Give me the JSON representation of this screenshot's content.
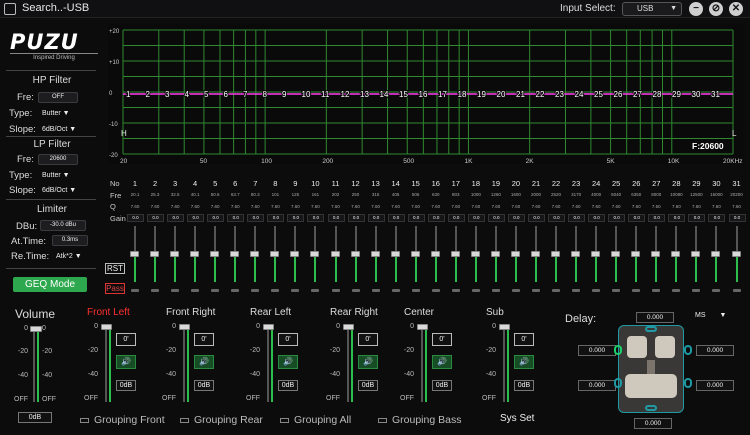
{
  "window": {
    "title": "Search..-USB",
    "input_select_label": "Input Select:",
    "input_select_value": "USB",
    "minimize_icon": "minus-icon",
    "restore_icon": "restore-icon",
    "close_icon": "close-icon"
  },
  "brand": {
    "logo": "PUZU",
    "tagline": "Inspired Driving"
  },
  "hp_filter": {
    "title": "HP Filter",
    "freq_label": "Fre:",
    "freq_value": "OFF",
    "type_label": "Type:",
    "type_value": "Butter",
    "slope_label": "Slope:",
    "slope_value": "6dB/Oct"
  },
  "lp_filter": {
    "title": "LP Filter",
    "freq_label": "Fre:",
    "freq_value": "20600",
    "type_label": "Type:",
    "type_value": "Butter",
    "slope_label": "Slope:",
    "slope_value": "6dB/Oct"
  },
  "limiter": {
    "title": "Limiter",
    "dbu_label": "DBu:",
    "dbu_value": "-30.0 dBu",
    "attime_label": "At.Time:",
    "attime_value": "0.3ms",
    "retime_label": "Re.Time:",
    "retime_value": "Atk*2"
  },
  "geq_button": "GEQ Mode",
  "graph": {
    "y_labels": [
      "+20",
      "+10",
      "0",
      "-10",
      "-20"
    ],
    "x_labels": [
      "20",
      "50",
      "100",
      "200",
      "500",
      "1K",
      "2K",
      "5K",
      "10K",
      "20KHz"
    ],
    "h_marker": "H",
    "l_marker": "L",
    "freq_readout": "F:20600",
    "point_labels": [
      "1",
      "2",
      "3",
      "4",
      "5",
      "6",
      "7",
      "8",
      "9",
      "10",
      "11",
      "12",
      "13",
      "14",
      "15",
      "16",
      "17",
      "18",
      "19",
      "20",
      "21",
      "22",
      "23",
      "24",
      "25",
      "26",
      "27",
      "28",
      "29",
      "30",
      "31"
    ],
    "line_color": "#ff3bf0",
    "grid_color": "#2f8a2f"
  },
  "table": {
    "no_label": "No",
    "fre_label": "Fre",
    "q_label": "Q",
    "gain_label": "Gain",
    "numbers": [
      "1",
      "2",
      "3",
      "4",
      "5",
      "6",
      "7",
      "8",
      "9",
      "10",
      "11",
      "12",
      "13",
      "14",
      "15",
      "16",
      "17",
      "18",
      "19",
      "20",
      "21",
      "22",
      "23",
      "24",
      "25",
      "26",
      "27",
      "28",
      "29",
      "30",
      "31"
    ],
    "freqs": [
      "20.1",
      "25.3",
      "32.5",
      "40.1",
      "50.6",
      "63.7",
      "80.3",
      "101",
      "125",
      "161",
      "202",
      "250",
      "315",
      "405",
      "506",
      "630",
      "803",
      "1000",
      "1260",
      "1600",
      "2000",
      "2520",
      "3170",
      "4000",
      "5040",
      "6350",
      "8000",
      "10080",
      "12500",
      "16000",
      "20200"
    ],
    "q": [
      "7.60",
      "7.60",
      "7.60",
      "7.60",
      "7.60",
      "7.60",
      "7.60",
      "7.60",
      "7.60",
      "7.60",
      "7.60",
      "7.60",
      "7.60",
      "7.60",
      "7.60",
      "7.60",
      "7.60",
      "7.60",
      "7.60",
      "7.60",
      "7.60",
      "7.60",
      "7.60",
      "7.60",
      "7.60",
      "7.60",
      "7.60",
      "7.60",
      "7.60",
      "7.60",
      "7.60"
    ],
    "gains": [
      "0.0",
      "0.0",
      "0.0",
      "0.0",
      "0.0",
      "0.0",
      "0.0",
      "0.0",
      "0.0",
      "0.0",
      "0.0",
      "0.0",
      "0.0",
      "0.0",
      "0.0",
      "0.0",
      "0.0",
      "0.0",
      "0.0",
      "0.0",
      "0.0",
      "0.0",
      "0.0",
      "0.0",
      "0.0",
      "0.0",
      "0.0",
      "0.0",
      "0.0",
      "0.0",
      "0.0"
    ],
    "rst_label": "RST",
    "pass_label": "Pass"
  },
  "volume": {
    "title": "Volume",
    "scale": [
      "0",
      "-20",
      "-40",
      "OFF"
    ],
    "value": "0dB"
  },
  "channels": [
    {
      "name": "Front Left",
      "color": "#ff3030",
      "phase": "0'",
      "db": "0dB",
      "speaker_icon": "speaker-icon"
    },
    {
      "name": "Front Right",
      "color": "#dddddd",
      "phase": "0'",
      "db": "0dB",
      "speaker_icon": "speaker-icon"
    },
    {
      "name": "Rear Left",
      "color": "#dddddd",
      "phase": "0'",
      "db": "0dB",
      "speaker_icon": "speaker-icon"
    },
    {
      "name": "Rear Right",
      "color": "#dddddd",
      "phase": "0'",
      "db": "0dB",
      "speaker_icon": "speaker-icon"
    },
    {
      "name": "Center",
      "color": "#dddddd",
      "phase": "0'",
      "db": "0dB",
      "speaker_icon": "speaker-icon"
    },
    {
      "name": "Sub",
      "color": "#dddddd",
      "phase": "0'",
      "db": "0dB",
      "speaker_icon": "speaker-icon"
    }
  ],
  "channel_scale": [
    "0",
    "-20",
    "-40",
    "OFF"
  ],
  "grouping": [
    "Grouping Front",
    "Grouping Rear",
    "Grouping All",
    "Grouping Bass"
  ],
  "sys_set": "Sys Set",
  "delay": {
    "title": "Delay:",
    "unit": "MS",
    "top": "0.000",
    "left": "0.000",
    "right": "0.000",
    "bottom_left": "0.000",
    "bottom_right": "0.000",
    "bottom": "0.000"
  }
}
